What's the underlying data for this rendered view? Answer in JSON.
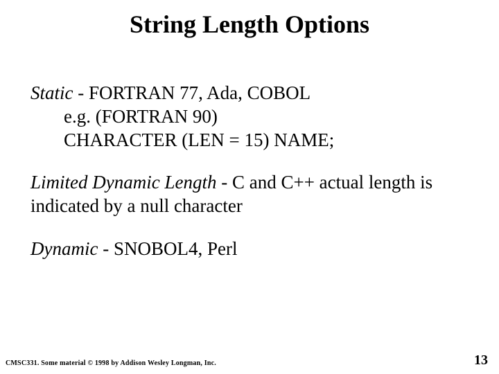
{
  "title": "String Length Options",
  "blocks": {
    "static": {
      "label": "Static",
      "rest": " - FORTRAN 77, Ada, COBOL",
      "line2": "e.g. (FORTRAN 90)",
      "line3": "CHARACTER (LEN = 15) NAME;"
    },
    "limited": {
      "label": "Limited Dynamic Length",
      "rest": " - C and C++ actual length is indicated by a null character"
    },
    "dynamic": {
      "label": "Dynamic",
      "rest": " - SNOBOL4, Perl"
    }
  },
  "footer": {
    "left": "CMSC331. Some material © 1998 by Addison Wesley Longman, Inc.",
    "page": "13"
  }
}
